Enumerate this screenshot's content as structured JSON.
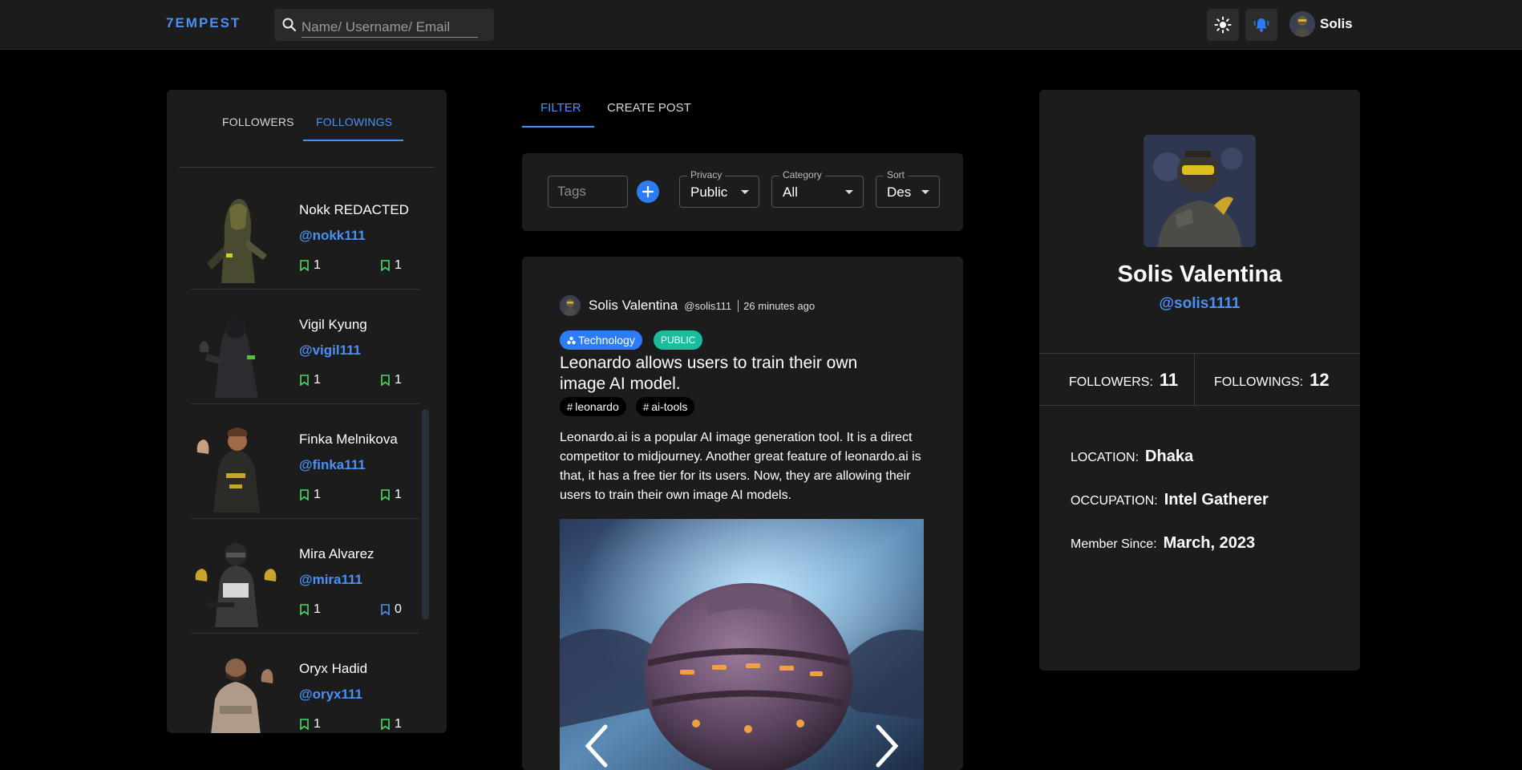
{
  "app": {
    "brand": "7EMPEST"
  },
  "search": {
    "placeholder": "Name/ Username/ Email"
  },
  "topbar": {
    "user_name": "Solis"
  },
  "left_panel": {
    "tabs": [
      {
        "label": "FOLLOWERS"
      },
      {
        "label": "FOLLOWINGS"
      }
    ],
    "people": [
      {
        "name": "Nokk REDACTED",
        "username": "@nokk111",
        "stat_a": "1",
        "stat_b": "1"
      },
      {
        "name": "Vigil Kyung",
        "username": "@vigil111",
        "stat_a": "1",
        "stat_b": "1"
      },
      {
        "name": "Finka Melnikova",
        "username": "@finka111",
        "stat_a": "1",
        "stat_b": "1"
      },
      {
        "name": "Mira Alvarez",
        "username": "@mira111",
        "stat_a": "1",
        "stat_b": "0"
      },
      {
        "name": "Oryx Hadid",
        "username": "@oryx111",
        "stat_a": "1",
        "stat_b": "1"
      }
    ]
  },
  "middle": {
    "tabs": [
      {
        "label": "FILTER"
      },
      {
        "label": "CREATE POST"
      }
    ],
    "filter": {
      "tags_placeholder": "Tags",
      "privacy": {
        "label": "Privacy",
        "value": "Public"
      },
      "category": {
        "label": "Category",
        "value": "All"
      },
      "sort": {
        "label": "Sort",
        "value": "Des"
      }
    },
    "post": {
      "author": "Solis Valentina",
      "handle": "@solis111",
      "time": "26 minutes ago",
      "category": "Technology",
      "privacy": "PUBLIC",
      "title": "Leonardo allows users to train their own image AI model.",
      "tags": [
        "leonardo",
        "ai-tools"
      ],
      "body": "Leonardo.ai is a popular AI image generation tool. It is a direct competitor to midjourney. Another great feature of leonardo.ai is that, it has a free tier for its users. Now, they are allowing their users to train their own image AI models."
    }
  },
  "profile": {
    "name": "Solis Valentina",
    "username": "@solis1111",
    "followers_label": "FOLLOWERS:",
    "followers_count": "11",
    "followings_label": "FOLLOWINGS:",
    "followings_count": "12",
    "location_label": "LOCATION:",
    "location": "Dhaka",
    "occupation_label": "OCCUPATION:",
    "occupation": "Intel Gatherer",
    "member_label": "Member Since:",
    "member_since": "March, 2023"
  },
  "colors": {
    "accent": "#4a90f5",
    "panel": "#1c1c1c",
    "background": "#000000",
    "badge_public": "#1abc9c",
    "stat_icon_green": "#4cd964"
  }
}
